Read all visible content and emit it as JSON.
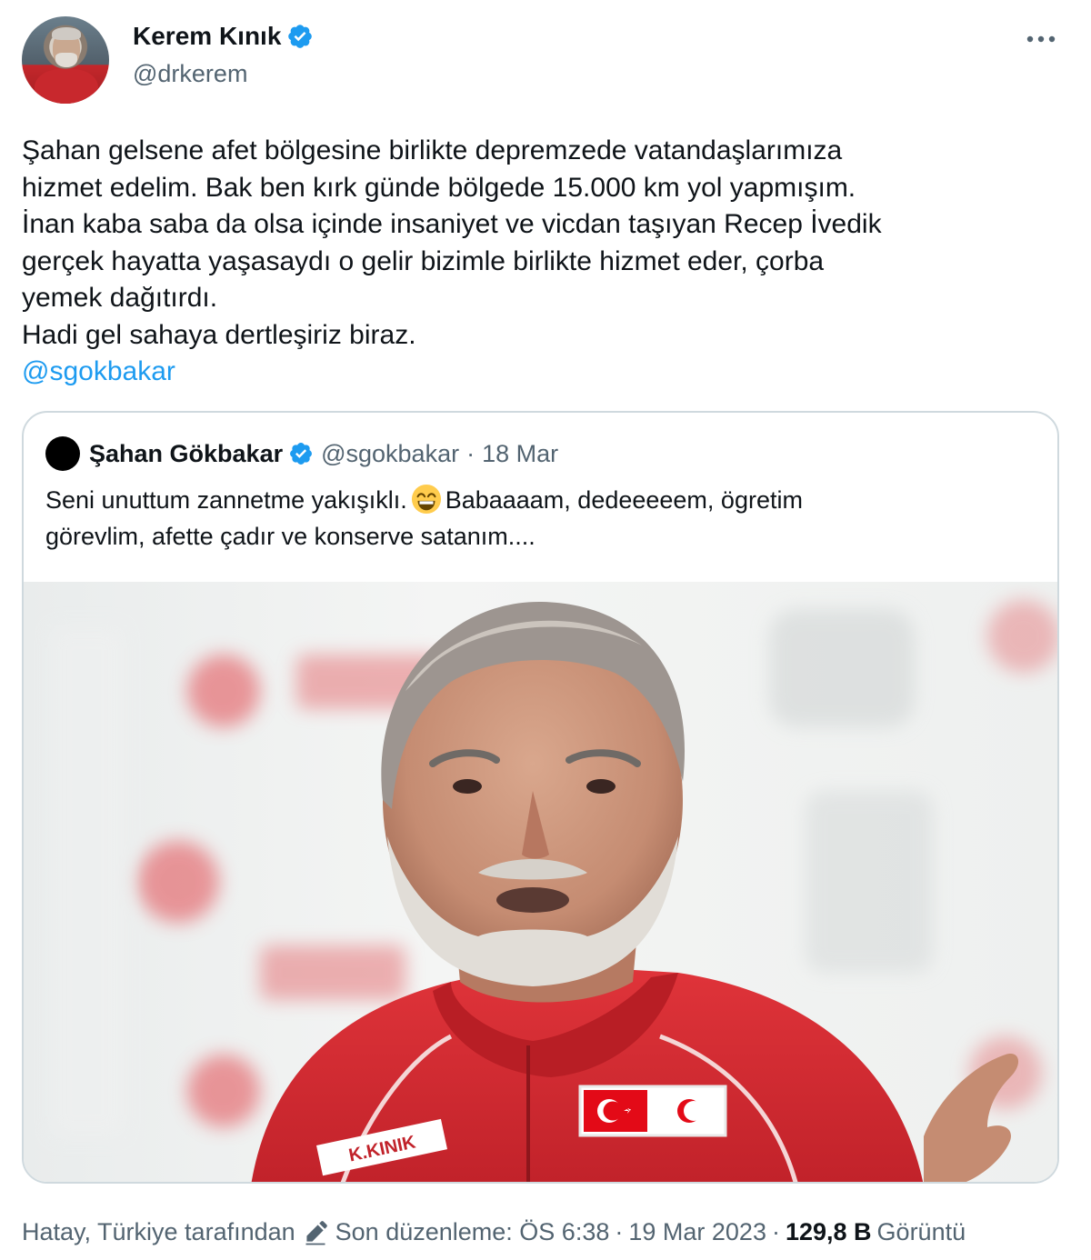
{
  "author": {
    "display_name": "Kerem Kınık",
    "handle": "@drkerem",
    "verified": true
  },
  "tweet": {
    "lines": [
      "Şahan gelsene afet bölgesine birlikte depremzede vatandaşlarımıza",
      "hizmet edelim. Bak ben kırk günde bölgede 15.000 km yol yapmışım.",
      "İnan kaba saba da olsa içinde insaniyet ve vicdan taşıyan Recep İvedik",
      "gerçek hayatta yaşasaydı o gelir bizimle birlikte hizmet eder, çorba",
      "yemek dağıtırdı.",
      "Hadi gel sahaya dertleşiriz biraz."
    ],
    "mention": "@sgokbakar"
  },
  "quote": {
    "display_name": "Şahan Gökbakar",
    "handle": "@sgokbakar",
    "separator": "·",
    "date": "18 Mar",
    "line1_before_emoji": "Seni unuttum zannetme yakışıklı.",
    "emoji": "grinning-face-with-smiling-eyes",
    "line1_after_emoji": "Babaaaam, dedeeeeem, ögretim",
    "line2": "görevlim, afette çadır ve konserve satanım....",
    "photo": {
      "jacket_name_patch": "K.KINIK",
      "colors": {
        "jacket": "#d72b2f",
        "background": "#eef0ef"
      }
    }
  },
  "footer": {
    "location": "Hatay, Türkiye tarafından",
    "edited_label": "Son düzenleme: ÖS 6:38",
    "separator": "·",
    "date": "19 Mar 2023",
    "views_count": "129,8 B",
    "views_label": "Görüntü"
  },
  "colors": {
    "accent": "#1d9bf0",
    "text": "#0f1419",
    "secondary": "#536471",
    "border": "#cfd9de"
  }
}
